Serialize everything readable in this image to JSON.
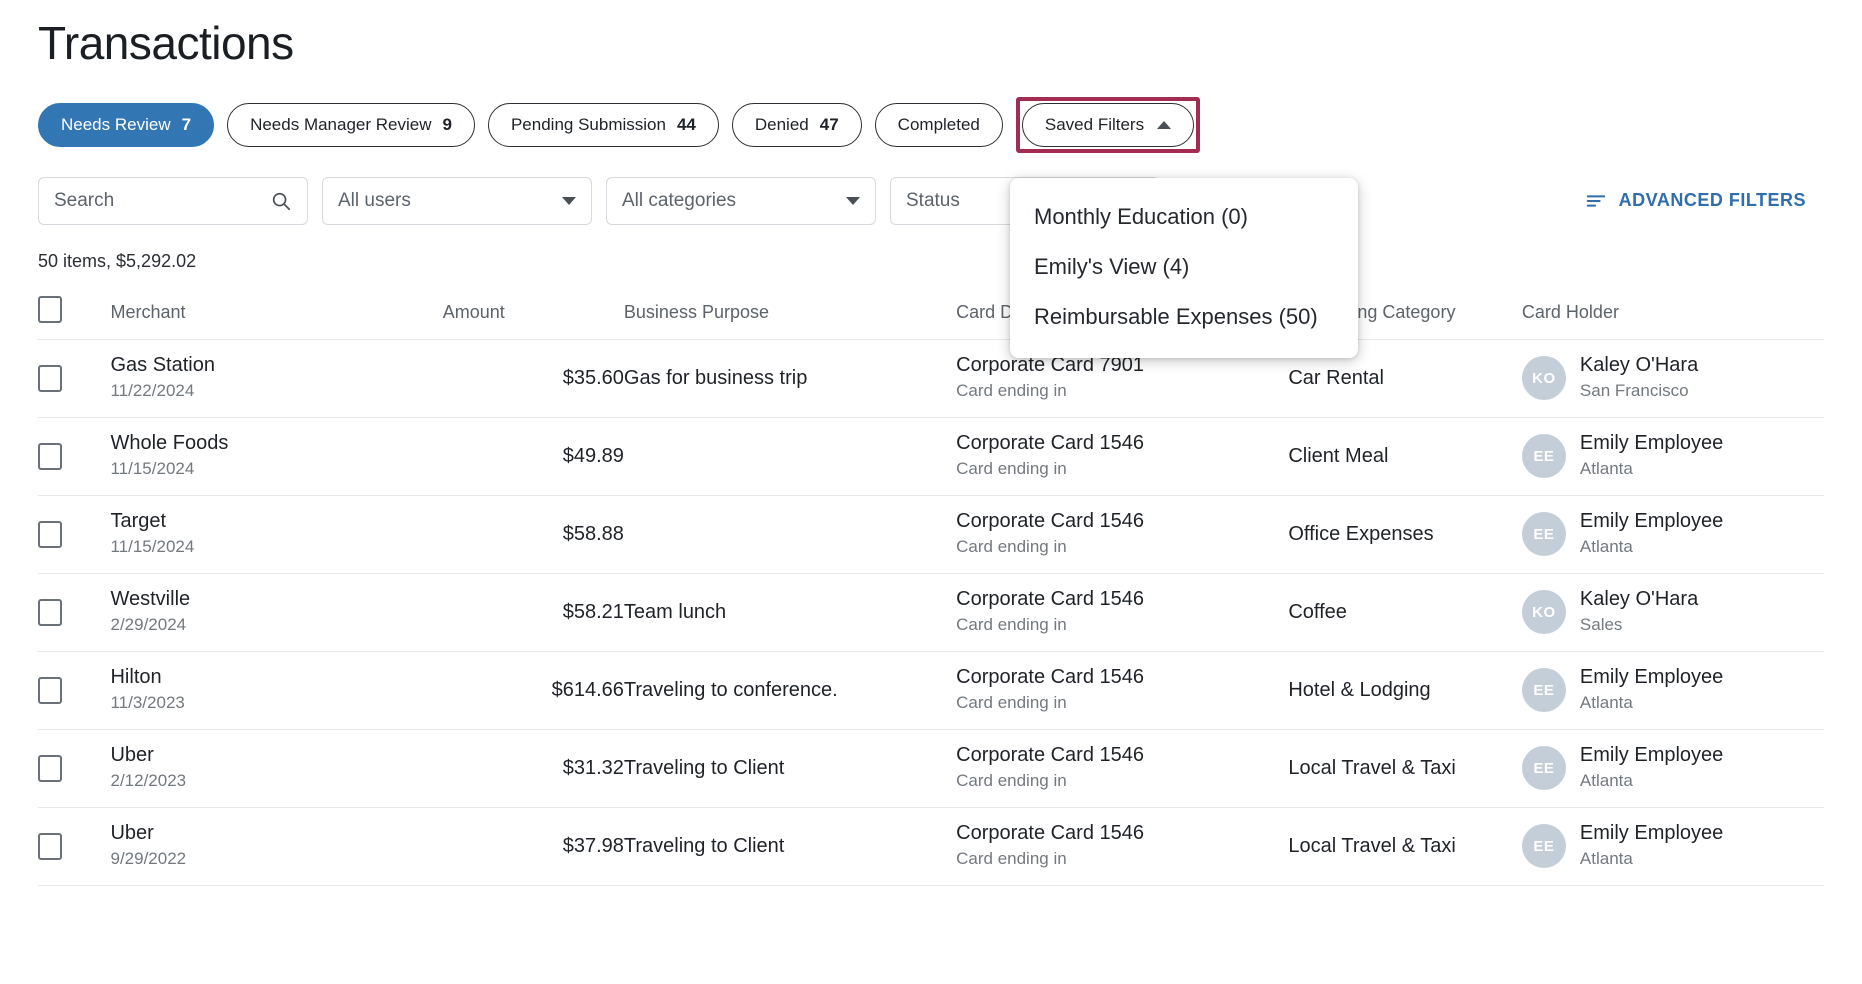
{
  "page": {
    "title": "Transactions"
  },
  "chips": [
    {
      "label": "Needs Review",
      "count": "7",
      "active": true
    },
    {
      "label": "Needs Manager Review",
      "count": "9",
      "active": false
    },
    {
      "label": "Pending Submission",
      "count": "44",
      "active": false
    },
    {
      "label": "Denied",
      "count": "47",
      "active": false
    },
    {
      "label": "Completed",
      "count": "",
      "active": false
    }
  ],
  "saved_filters": {
    "label": "Saved Filters",
    "expanded": true,
    "highlight_color": "#a32c52",
    "items": [
      "Monthly Education (0)",
      "Emily's View (4)",
      "Reimbursable Expenses (50)"
    ]
  },
  "filters": {
    "search_placeholder": "Search",
    "users_value": "All users",
    "categories_value": "All categories",
    "status_value": "Status",
    "advanced_filters_label": "ADVANCED FILTERS",
    "advanced_filters_color": "#2f6eab"
  },
  "summary": "50 items, $5,292.02",
  "table": {
    "columns": [
      "Merchant",
      "Amount",
      "Business Purpose",
      "Card Details",
      "Accounting Category",
      "Card Holder"
    ],
    "rows": [
      {
        "merchant": "Gas Station",
        "date": "11/22/2024",
        "amount": "$35.60",
        "purpose": "Gas for business trip",
        "card": "Corporate Card 7901",
        "card_sub": "Card ending in",
        "category": "Car Rental",
        "holder": "Kaley O'Hara",
        "holder_sub": "San Francisco",
        "initials": "KO"
      },
      {
        "merchant": "Whole Foods",
        "date": "11/15/2024",
        "amount": "$49.89",
        "purpose": "",
        "card": "Corporate Card 1546",
        "card_sub": "Card ending in",
        "category": "Client Meal",
        "holder": "Emily Employee",
        "holder_sub": "Atlanta",
        "initials": "EE"
      },
      {
        "merchant": "Target",
        "date": "11/15/2024",
        "amount": "$58.88",
        "purpose": "",
        "card": "Corporate Card 1546",
        "card_sub": "Card ending in",
        "category": "Office Expenses",
        "holder": "Emily Employee",
        "holder_sub": "Atlanta",
        "initials": "EE"
      },
      {
        "merchant": "Westville",
        "date": "2/29/2024",
        "amount": "$58.21",
        "purpose": "Team lunch",
        "card": "Corporate Card 1546",
        "card_sub": "Card ending in",
        "category": "Coffee",
        "holder": "Kaley O'Hara",
        "holder_sub": "Sales",
        "initials": "KO"
      },
      {
        "merchant": "Hilton",
        "date": "11/3/2023",
        "amount": "$614.66",
        "purpose": "Traveling to conference.",
        "card": "Corporate Card 1546",
        "card_sub": "Card ending in",
        "category": "Hotel & Lodging",
        "holder": "Emily Employee",
        "holder_sub": "Atlanta",
        "initials": "EE"
      },
      {
        "merchant": "Uber",
        "date": "2/12/2023",
        "amount": "$31.32",
        "purpose": "Traveling to Client",
        "card": "Corporate Card 1546",
        "card_sub": "Card ending in",
        "category": "Local Travel & Taxi",
        "holder": "Emily Employee",
        "holder_sub": "Atlanta",
        "initials": "EE"
      },
      {
        "merchant": "Uber",
        "date": "9/29/2022",
        "amount": "$37.98",
        "purpose": "Traveling to Client",
        "card": "Corporate Card 1546",
        "card_sub": "Card ending in",
        "category": "Local Travel & Taxi",
        "holder": "Emily Employee",
        "holder_sub": "Atlanta",
        "initials": "EE"
      }
    ]
  }
}
